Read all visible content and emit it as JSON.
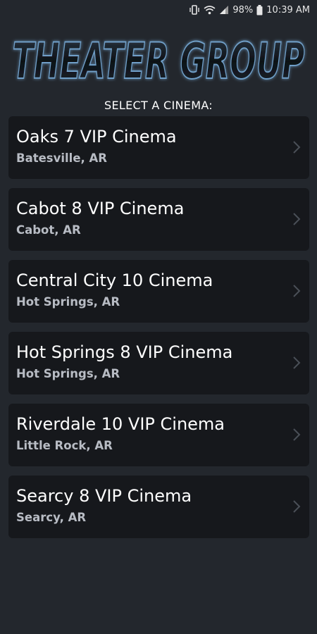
{
  "status_bar": {
    "battery": "98%",
    "time": "10:39 AM",
    "icons": [
      "vibrate-icon",
      "wifi-icon",
      "signal-icon",
      "battery-icon"
    ]
  },
  "header": {
    "logo_text": "THEATER GROUP",
    "subtitle": "SELECT A CINEMA:"
  },
  "cinemas": [
    {
      "name": "Oaks 7 VIP Cinema",
      "location": "Batesville, AR"
    },
    {
      "name": "Cabot 8 VIP Cinema",
      "location": "Cabot, AR"
    },
    {
      "name": "Central City 10 Cinema",
      "location": "Hot Springs, AR"
    },
    {
      "name": "Hot Springs 8 VIP Cinema",
      "location": "Hot Springs, AR"
    },
    {
      "name": "Riverdale 10 VIP Cinema",
      "location": "Little Rock, AR"
    },
    {
      "name": "Searcy 8 VIP Cinema",
      "location": "Searcy, AR"
    }
  ],
  "colors": {
    "background": "#23272d",
    "card": "#16181c",
    "logo_glow": "#5f8fb8"
  }
}
